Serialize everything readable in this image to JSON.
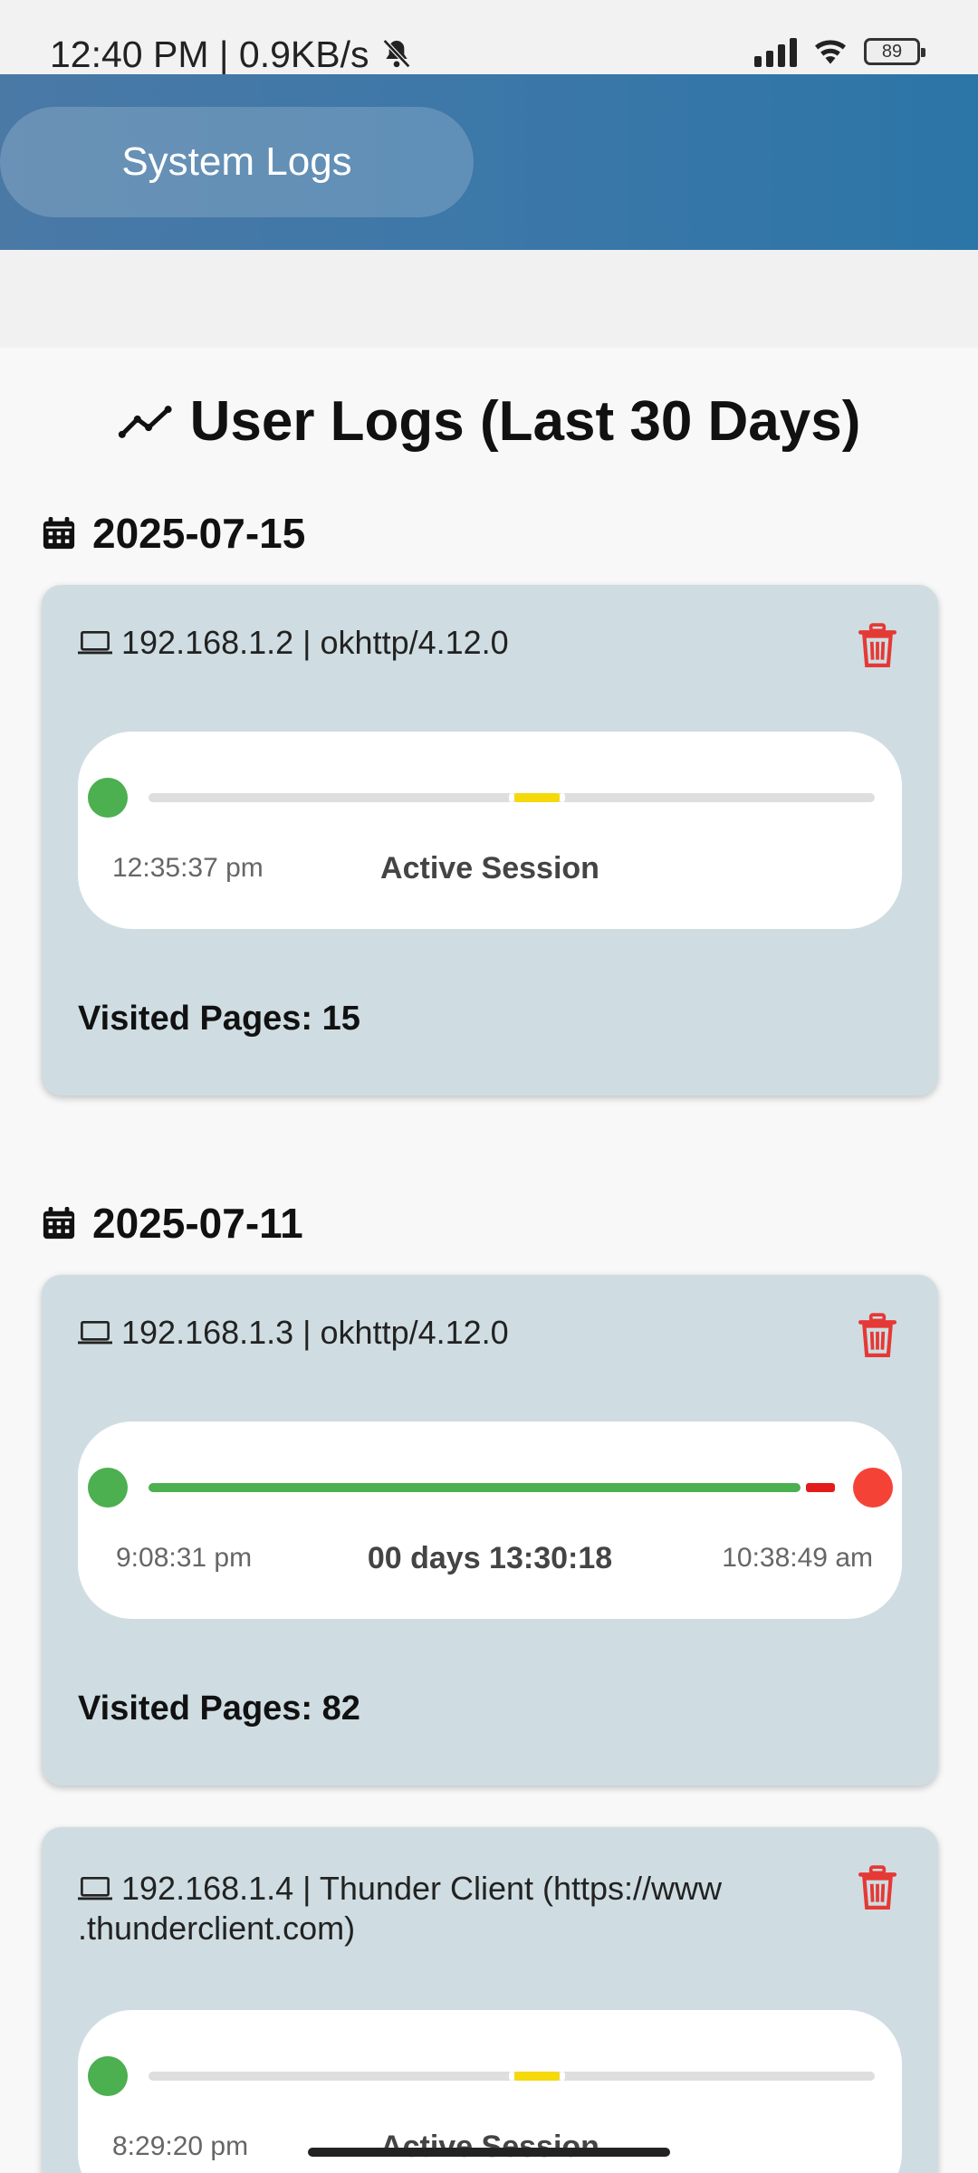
{
  "status_bar": {
    "time": "12:40 PM | 0.9KB/s",
    "battery": "89",
    "icons": [
      "bell-off-icon",
      "signal-icon",
      "wifi-icon",
      "battery-icon"
    ]
  },
  "header": {
    "title": "System Logs"
  },
  "section": {
    "title": "User Logs (Last 30 Days)",
    "icon": "trend-icon"
  },
  "groups": [
    {
      "date": "2025-07-15",
      "logs": [
        {
          "client": "192.168.1.2 | okhttp/4.12.0",
          "start_time": "12:35:37 pm",
          "status": "Active Session",
          "end_time": "",
          "visited_label": "Visited Pages: 15"
        }
      ]
    },
    {
      "date": "2025-07-11",
      "logs": [
        {
          "client": "192.168.1.3 | okhttp/4.12.0",
          "start_time": "9:08:31 pm",
          "status": "00 days 13:30:18",
          "end_time": "10:38:49 am",
          "visited_label": "Visited Pages: 82"
        },
        {
          "client": "192.168.1.4 | Thunder Client (https://www .thunderclient.com)",
          "start_time": "8:29:20 pm",
          "status": "Active Session",
          "end_time": ""
        }
      ]
    }
  ],
  "colors": {
    "header_gradient_start": "#4a79a6",
    "header_gradient_end": "#2c75a7",
    "card_bg": "#cfdde2",
    "active_dot": "#4caf50",
    "end_dot": "#f44336",
    "active_marker": "#f5d90a",
    "trash": "#e53935"
  }
}
